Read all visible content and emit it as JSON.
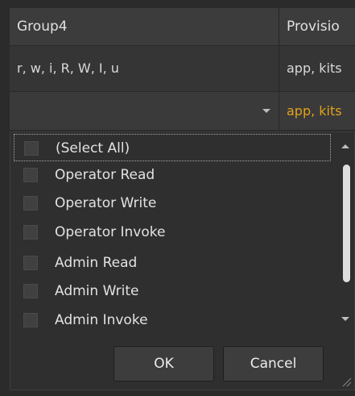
{
  "grid": {
    "columns": [
      "Group4",
      "Provisio"
    ],
    "row": [
      "r, w, i, R, W, I, u",
      "app, kits"
    ],
    "filter": {
      "col1_value": "",
      "col2_value": "app, kits"
    }
  },
  "filter_popup": {
    "items": [
      {
        "label": "(Select All)",
        "checked": false
      },
      {
        "label": "Operator Read",
        "checked": false
      },
      {
        "label": "Operator Write",
        "checked": false
      },
      {
        "label": "Operator Invoke",
        "checked": false
      },
      {
        "label": "Admin Read",
        "checked": false
      },
      {
        "label": "Admin Write",
        "checked": false
      },
      {
        "label": "Admin Invoke",
        "checked": false
      }
    ],
    "ok_label": "OK",
    "cancel_label": "Cancel"
  },
  "colors": {
    "background": "#2b2b2b",
    "header_bg": "#3c3c3c",
    "filter_text": "#e3a21a",
    "checkbox_bg": "#404040"
  }
}
